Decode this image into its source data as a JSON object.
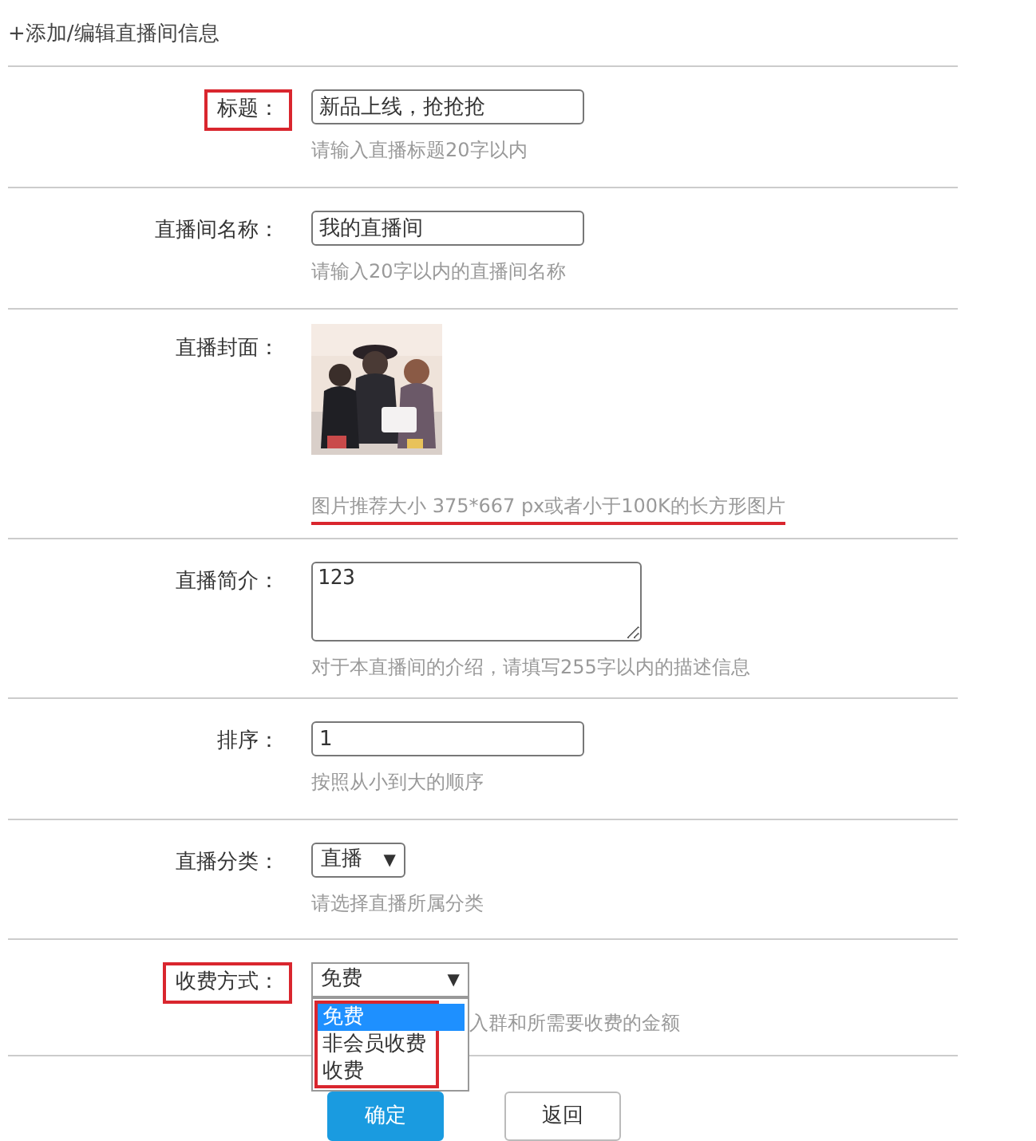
{
  "heading": "+添加/编辑直播间信息",
  "fields": [
    {
      "kind": "input",
      "label": "标题：",
      "label_highlighted": true,
      "value": "新品上线，抢抢抢",
      "hint": "请输入直播标题20字以内",
      "hint_underlined": false
    },
    {
      "kind": "input",
      "label": "直播间名称：",
      "label_highlighted": false,
      "value": "我的直播间",
      "hint": "请输入20字以内的直播间名称",
      "hint_underlined": false
    },
    {
      "label": "直播封面：",
      "label_highlighted": false,
      "hint": "图片推荐大小 375*667 px或者小于100K的长方形图片",
      "hint_underlined": true
    },
    {
      "kind": "textarea",
      "label": "直播简介：",
      "label_highlighted": false,
      "value": "123",
      "hint": "对于本直播间的介绍，请填写255字以内的描述信息",
      "hint_underlined": false
    },
    {
      "kind": "input",
      "label": "排序：",
      "label_highlighted": false,
      "value": "1",
      "hint": "按照从小到大的顺序",
      "hint_underlined": false
    },
    {
      "kind": "select",
      "label": "直播分类：",
      "label_highlighted": false,
      "value": "直播",
      "arrow": "▼",
      "hint": "请选择直播所属分类",
      "hint_underlined": false
    },
    {
      "kind": "dropdown",
      "label": "收费方式：",
      "label_highlighted": true,
      "value": "免费",
      "arrow": "▼",
      "expanded": true,
      "options_highlighted": true,
      "options": [
        {
          "label": "免费",
          "selected": true
        },
        {
          "label": "非会员收费",
          "selected": false
        },
        {
          "label": "收费",
          "selected": false
        }
      ],
      "hint": "入群和所需要收费的金额",
      "hint_underlined": false
    }
  ],
  "buttons": [
    {
      "kind": "primary",
      "label": "确定"
    },
    {
      "kind": "default",
      "label": "返回"
    }
  ]
}
